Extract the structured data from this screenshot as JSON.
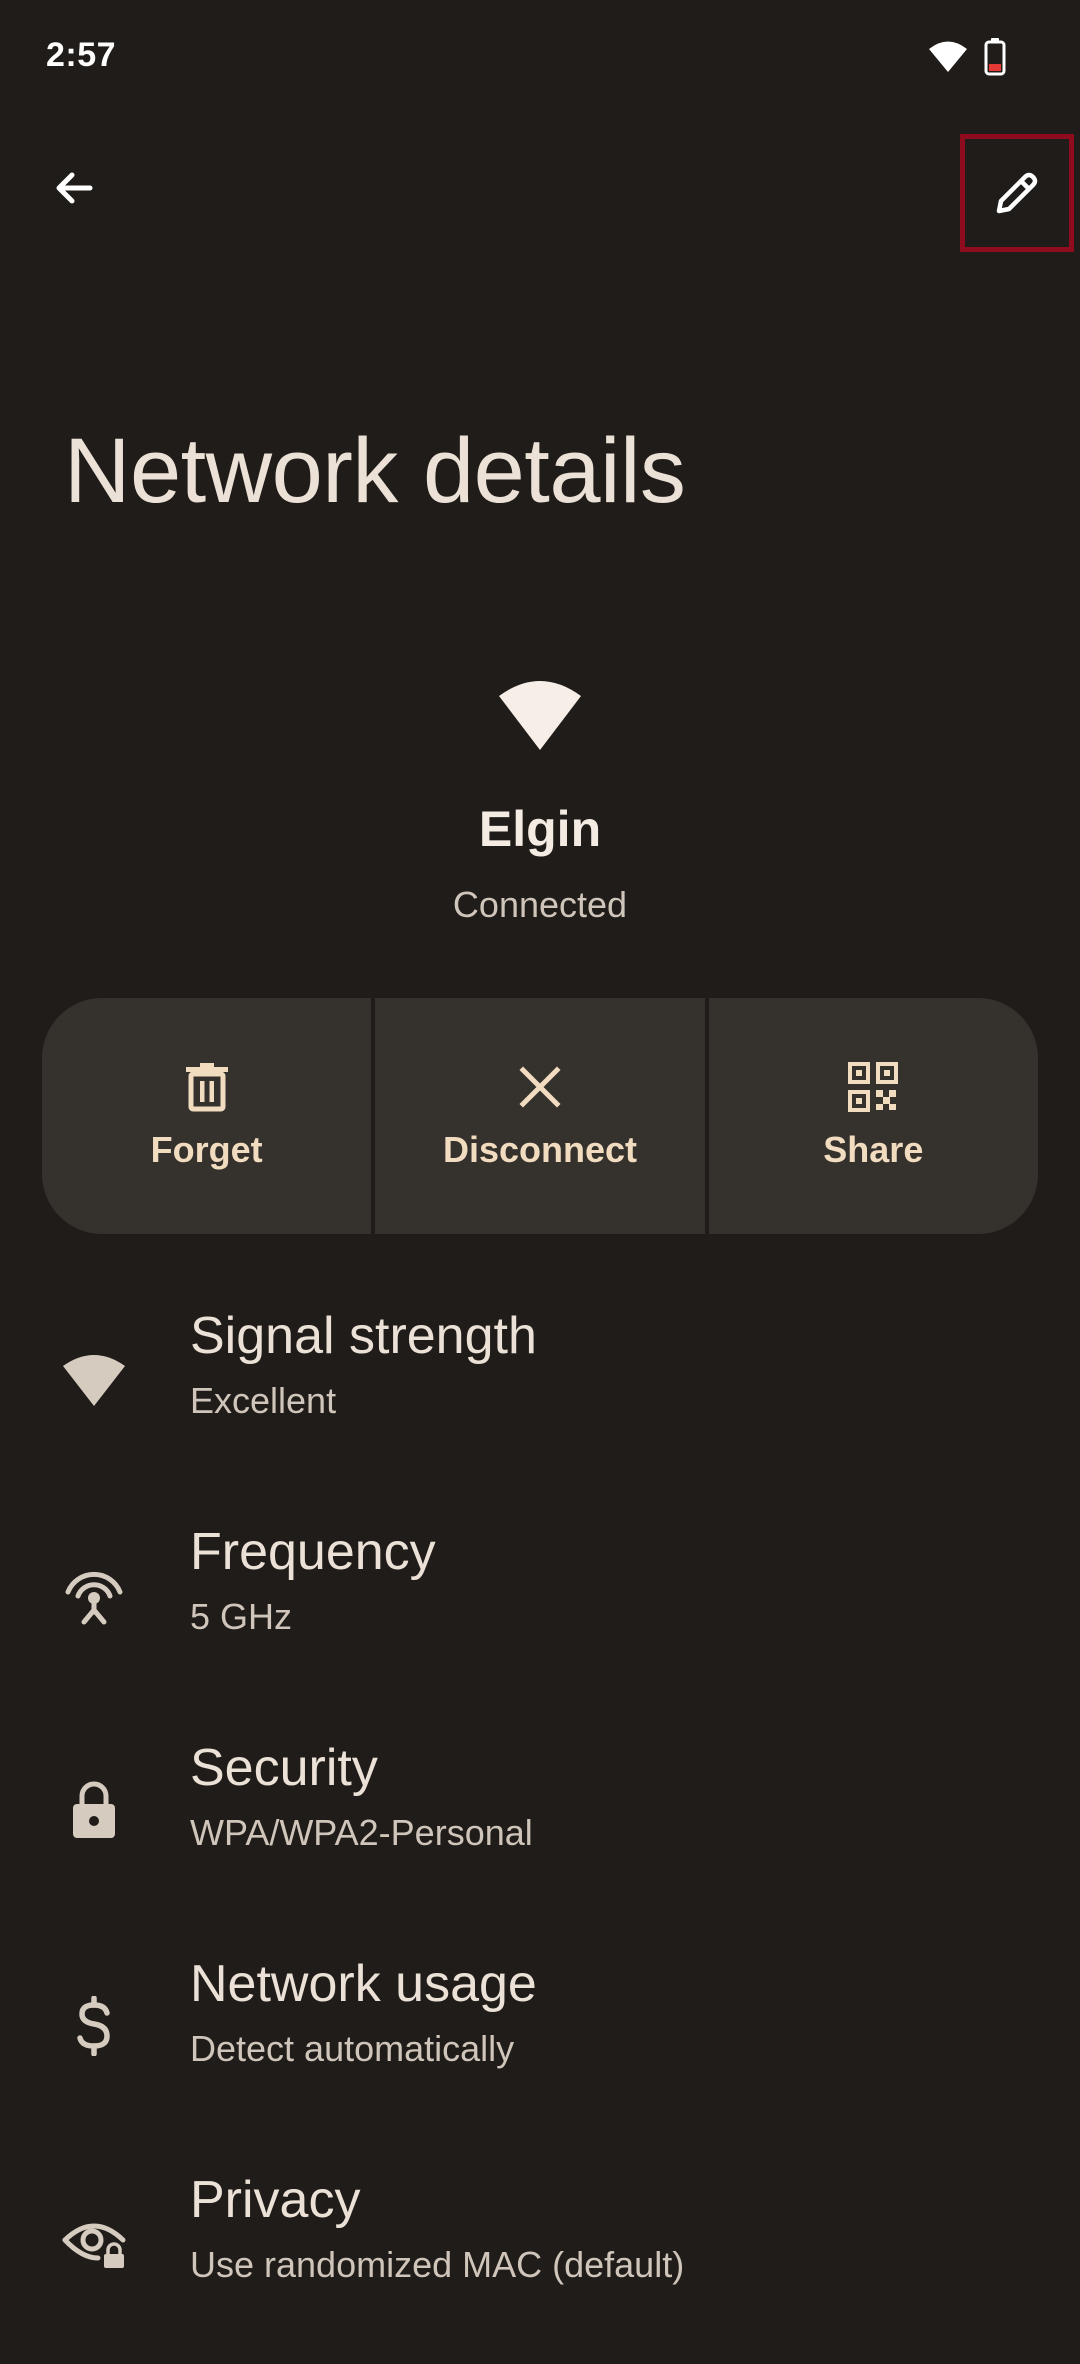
{
  "status_bar": {
    "time": "2:57",
    "wifi_icon": "wifi-icon",
    "battery_icon": "battery-icon"
  },
  "toolbar": {
    "back_icon": "arrow-back-icon",
    "edit_icon": "pencil-icon"
  },
  "page": {
    "title": "Network details"
  },
  "network": {
    "icon": "wifi-icon",
    "name": "Elgin",
    "status": "Connected"
  },
  "actions": [
    {
      "label": "Forget",
      "icon": "trash-icon"
    },
    {
      "label": "Disconnect",
      "icon": "close-icon"
    },
    {
      "label": "Share",
      "icon": "qr-code-icon"
    }
  ],
  "details": [
    {
      "title": "Signal strength",
      "value": "Excellent",
      "icon": "wifi-icon"
    },
    {
      "title": "Frequency",
      "value": "5 GHz",
      "icon": "broadcast-icon"
    },
    {
      "title": "Security",
      "value": "WPA/WPA2-Personal",
      "icon": "lock-icon"
    },
    {
      "title": "Network usage",
      "value": "Detect automatically",
      "icon": "dollar-icon"
    },
    {
      "title": "Privacy",
      "value": "Use randomized MAC (default)",
      "icon": "eye-lock-icon"
    }
  ],
  "colors": {
    "background": "#1f1c19",
    "surface": "#35312d",
    "accent": "#f1dcc0",
    "highlight_border": "#8e0c1d"
  }
}
